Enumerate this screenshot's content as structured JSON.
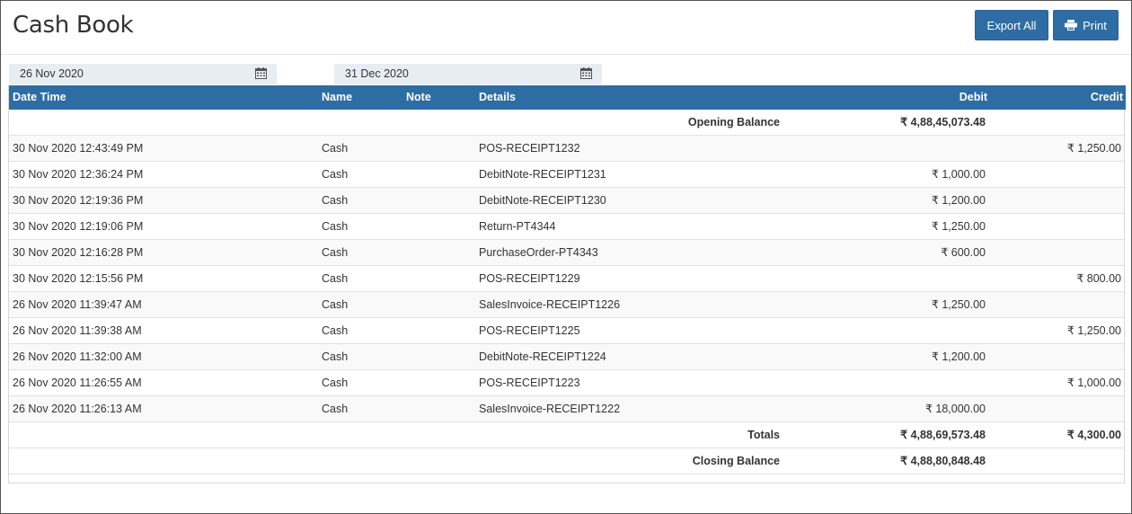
{
  "page": {
    "title": "Cash Book",
    "export_label": "Export All",
    "print_label": "Print",
    "date_from": "26 Nov 2020",
    "date_to": "31 Dec 2020"
  },
  "table": {
    "headers": {
      "datetime": "Date Time",
      "name": "Name",
      "note": "Note",
      "details": "Details",
      "debit": "Debit",
      "credit": "Credit"
    },
    "opening": {
      "label": "Opening Balance",
      "debit": "₹ 4,88,45,073.48"
    },
    "rows": [
      {
        "datetime": "30 Nov 2020 12:43:49 PM",
        "name": "Cash",
        "details": "POS-RECEIPT1232",
        "debit": "",
        "credit": "₹ 1,250.00"
      },
      {
        "datetime": "30 Nov 2020 12:36:24 PM",
        "name": "Cash",
        "details": "DebitNote-RECEIPT1231",
        "debit": "₹ 1,000.00",
        "credit": ""
      },
      {
        "datetime": "30 Nov 2020 12:19:36 PM",
        "name": "Cash",
        "details": "DebitNote-RECEIPT1230",
        "debit": "₹ 1,200.00",
        "credit": ""
      },
      {
        "datetime": "30 Nov 2020 12:19:06 PM",
        "name": "Cash",
        "details": "Return-PT4344",
        "debit": "₹ 1,250.00",
        "credit": ""
      },
      {
        "datetime": "30 Nov 2020 12:16:28 PM",
        "name": "Cash",
        "details": "PurchaseOrder-PT4343",
        "debit": "₹ 600.00",
        "credit": ""
      },
      {
        "datetime": "30 Nov 2020 12:15:56 PM",
        "name": "Cash",
        "details": "POS-RECEIPT1229",
        "debit": "",
        "credit": "₹ 800.00"
      },
      {
        "datetime": "26 Nov 2020 11:39:47 AM",
        "name": "Cash",
        "details": "SalesInvoice-RECEIPT1226",
        "debit": "₹ 1,250.00",
        "credit": ""
      },
      {
        "datetime": "26 Nov 2020 11:39:38 AM",
        "name": "Cash",
        "details": "POS-RECEIPT1225",
        "debit": "",
        "credit": "₹ 1,250.00"
      },
      {
        "datetime": "26 Nov 2020 11:32:00 AM",
        "name": "Cash",
        "details": "DebitNote-RECEIPT1224",
        "debit": "₹ 1,200.00",
        "credit": ""
      },
      {
        "datetime": "26 Nov 2020 11:26:55 AM",
        "name": "Cash",
        "details": "POS-RECEIPT1223",
        "debit": "",
        "credit": "₹ 1,000.00"
      },
      {
        "datetime": "26 Nov 2020 11:26:13 AM",
        "name": "Cash",
        "details": "SalesInvoice-RECEIPT1222",
        "debit": "₹ 18,000.00",
        "credit": ""
      }
    ],
    "totals": {
      "label": "Totals",
      "debit": "₹ 4,88,69,573.48",
      "credit": "₹ 4,300.00"
    },
    "closing": {
      "label": "Closing Balance",
      "debit": "₹ 4,88,80,848.48"
    }
  },
  "icons": {
    "calendar": "calendar-icon",
    "print": "printer-icon"
  },
  "colors": {
    "accent": "#2e6da4",
    "date_bg": "#e8edf4"
  }
}
